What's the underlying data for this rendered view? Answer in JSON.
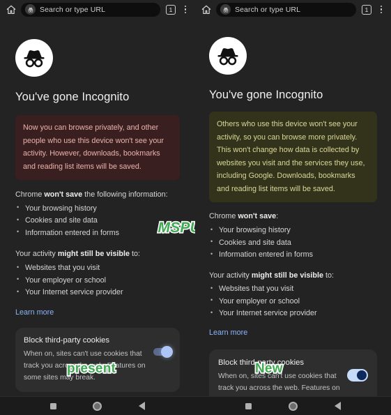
{
  "toolbar": {
    "home_icon": "home-icon",
    "incognito_icon": "incognito-avatar-icon",
    "omnibox_placeholder": "Search or type URL",
    "tab_count": "1",
    "menu_icon": "overflow-menu-icon"
  },
  "panels": [
    {
      "variant": "present",
      "watermark": "present",
      "title": "You've gone Incognito",
      "callout": "Now you can browse privately, and other people who use this device won't see your activity. However, downloads, bookmarks and reading list items will be saved.",
      "callout_bg": "#3a1f20",
      "callout_fg": "#eab3ad",
      "wont_save": {
        "head_before": "Chrome ",
        "head_bold": "won't save",
        "head_after": " the following information:",
        "items": [
          "Your browsing history",
          "Cookies and site data",
          "Information entered in forms"
        ]
      },
      "visible_to": {
        "head_before": "Your activity ",
        "head_bold": "might still be visible",
        "head_after": " to:",
        "items": [
          "Websites that you visit",
          "Your employer or school",
          "Your Internet service provider"
        ]
      },
      "learn_more": "Learn more",
      "card": {
        "title": "Block third-party cookies",
        "description": "When on, sites can't use cookies that track you across the web. Features on some sites may break.",
        "toggle_state": "on",
        "toggle_accent": "#adc6f6"
      }
    },
    {
      "variant": "new",
      "watermark": "New",
      "title": "You've gone Incognito",
      "callout": "Others who use this device won't see your activity, so you can browse more privately. This won't change how data is collected by websites you visit and the services they use, including Google. Downloads, bookmarks and reading list items will be saved.",
      "callout_bg": "#33331b",
      "callout_fg": "#d9d79a",
      "wont_save": {
        "head_before": "Chrome ",
        "head_bold": "won't save",
        "head_after": ":",
        "items": [
          "Your browsing history",
          "Cookies and site data",
          "Information entered in forms"
        ]
      },
      "visible_to": {
        "head_before": "Your activity ",
        "head_bold": "might still be visible",
        "head_after": " to:",
        "items": [
          "Websites that you visit",
          "Your employer or school",
          "Your Internet service provider"
        ]
      },
      "learn_more": "Learn more",
      "card": {
        "title": "Block third-party cookies",
        "description": "When on, sites can't use cookies that track you across the web. Features on some sites may break.",
        "toggle_state": "on",
        "toggle_accent": "#c6dcf8"
      }
    }
  ],
  "source_watermark": "MSPU",
  "navbar": {
    "recents_icon": "square-recents-icon",
    "home_icon": "circle-home-icon",
    "back_icon": "triangle-back-icon"
  }
}
